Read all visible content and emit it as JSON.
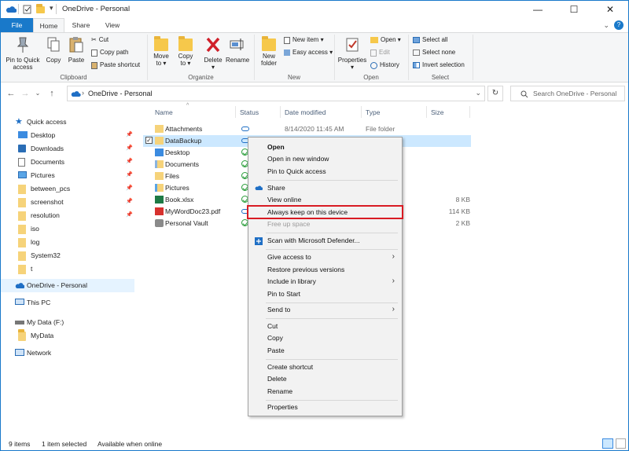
{
  "window": {
    "title": "OneDrive - Personal",
    "controls": {
      "minimize": "—",
      "maximize": "☐",
      "close": "✕"
    }
  },
  "ribbon_tabs": [
    "File",
    "Home",
    "Share",
    "View"
  ],
  "ribbon": {
    "clipboard": {
      "label": "Clipboard",
      "pin": "Pin to Quick\naccess",
      "copy": "Copy",
      "paste": "Paste",
      "cut": "Cut",
      "copy_path": "Copy path",
      "paste_shortcut": "Paste shortcut"
    },
    "organize": {
      "label": "Organize",
      "move_to": "Move\nto ▾",
      "copy_to": "Copy\nto ▾",
      "delete": "Delete\n▾",
      "rename": "Rename"
    },
    "new": {
      "label": "New",
      "new_folder": "New\nfolder",
      "new_item": "New item ▾",
      "easy_access": "Easy access ▾"
    },
    "open": {
      "label": "Open",
      "properties": "Properties\n▾",
      "open": "Open ▾",
      "edit": "Edit",
      "history": "History"
    },
    "select": {
      "label": "Select",
      "select_all": "Select all",
      "select_none": "Select none",
      "invert": "Invert selection"
    }
  },
  "address": {
    "path": "OneDrive - Personal",
    "search_placeholder": "Search OneDrive - Personal"
  },
  "nav": {
    "quick_access": "Quick access",
    "quick_items": [
      {
        "label": "Desktop",
        "pinned": true
      },
      {
        "label": "Downloads",
        "pinned": true
      },
      {
        "label": "Documents",
        "pinned": true
      },
      {
        "label": "Pictures",
        "pinned": true
      },
      {
        "label": "between_pcs",
        "pinned": true
      },
      {
        "label": "screenshot",
        "pinned": true
      },
      {
        "label": "resolution",
        "pinned": true
      },
      {
        "label": "iso",
        "pinned": false
      },
      {
        "label": "log",
        "pinned": false
      },
      {
        "label": "System32",
        "pinned": false
      },
      {
        "label": "t",
        "pinned": false
      }
    ],
    "onedrive": "OneDrive - Personal",
    "this_pc": "This PC",
    "my_data": "My Data (F:)",
    "my_data_sub": "MyData",
    "network": "Network"
  },
  "columns": {
    "name": "Name",
    "status": "Status",
    "date": "Date modified",
    "type": "Type",
    "size": "Size"
  },
  "files": [
    {
      "name": "Attachments",
      "status": "cloud",
      "date": "8/14/2020 11:45 AM",
      "type": "File folder",
      "size": "",
      "icon": "folder"
    },
    {
      "name": "DataBackup",
      "status": "cloud",
      "date": "",
      "type": "",
      "size": "",
      "icon": "folder",
      "selected": true
    },
    {
      "name": "Desktop",
      "status": "synced",
      "date": "",
      "type": "",
      "size": "",
      "icon": "folder-blue"
    },
    {
      "name": "Documents",
      "status": "synced",
      "date": "",
      "type": "",
      "size": "",
      "icon": "folder-doc"
    },
    {
      "name": "Files",
      "status": "synced",
      "date": "",
      "type": "",
      "size": "",
      "icon": "folder"
    },
    {
      "name": "Pictures",
      "status": "synced",
      "date": "",
      "type": "",
      "size": "",
      "icon": "folder-pic"
    },
    {
      "name": "Book.xlsx",
      "status": "synced",
      "date": "",
      "type": "cel W...",
      "size": "8 KB",
      "icon": "excel"
    },
    {
      "name": "MyWordDoc23.pdf",
      "status": "cloud",
      "date": "",
      "type": "ge P...",
      "size": "114 KB",
      "icon": "pdf"
    },
    {
      "name": "Personal Vault",
      "status": "synced",
      "date": "",
      "type": "",
      "size": "2 KB",
      "icon": "vault"
    }
  ],
  "context_menu": {
    "open": "Open",
    "open_new_window": "Open in new window",
    "pin_quick": "Pin to Quick access",
    "share": "Share",
    "view_online": "View online",
    "always_keep": "Always keep on this device",
    "free_up": "Free up space",
    "scan": "Scan with Microsoft Defender...",
    "give_access": "Give access to",
    "restore": "Restore previous versions",
    "include_library": "Include in library",
    "pin_start": "Pin to Start",
    "send_to": "Send to",
    "cut": "Cut",
    "copy": "Copy",
    "paste": "Paste",
    "create_shortcut": "Create shortcut",
    "delete": "Delete",
    "rename": "Rename",
    "properties": "Properties"
  },
  "status_bar": {
    "items": "9 items",
    "selected": "1 item selected",
    "availability": "Available when online"
  },
  "colors": {
    "accent": "#1979ca",
    "highlight_box": "#d81b23",
    "selection": "#cce8ff"
  }
}
